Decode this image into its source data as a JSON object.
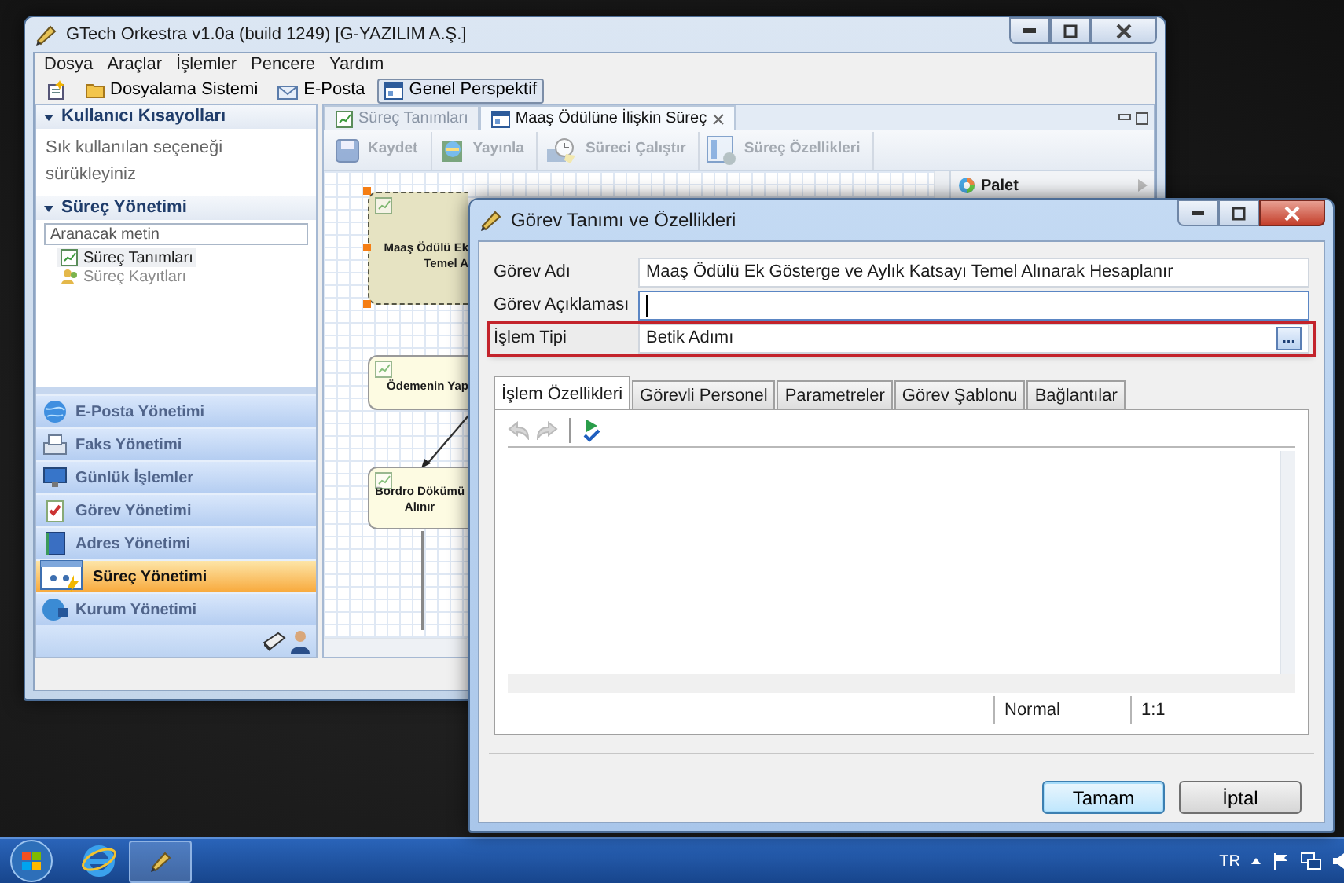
{
  "main_window": {
    "title": "GTech Orkestra v1.0a (build 1249) [G-YAZILIM A.Ş.]",
    "menu": [
      "Dosya",
      "Araçlar",
      "İşlemler",
      "Pencere",
      "Yardım"
    ],
    "toolbar": [
      {
        "kind": "new",
        "selected": false
      },
      {
        "kind": "folder",
        "label": "Dosyalama Sistemi",
        "selected": false
      },
      {
        "kind": "mail",
        "label": "E-Posta",
        "selected": false
      },
      {
        "kind": "perspective",
        "label": "Genel Perspektif",
        "selected": true
      }
    ],
    "sidebar": {
      "shortcuts": {
        "title": "Kullanıcı Kısayolları",
        "hint": "Sık kullanılan seçeneği sürükleyiniz"
      },
      "process": {
        "title": "Süreç Yönetimi",
        "search_placeholder": "Aranacak metin",
        "items": [
          {
            "label": "Süreç Tanımları",
            "selected": true,
            "disabled": false
          },
          {
            "label": "Süreç Kayıtları",
            "selected": false,
            "disabled": true
          }
        ]
      },
      "nav": [
        {
          "label": "E-Posta Yönetimi",
          "selected": false
        },
        {
          "label": "Faks Yönetimi",
          "selected": false
        },
        {
          "label": "Günlük İşlemler",
          "selected": false
        },
        {
          "label": "Görev Yönetimi",
          "selected": false
        },
        {
          "label": "Adres Yönetimi",
          "selected": false
        },
        {
          "label": "Süreç Yönetimi",
          "selected": true
        },
        {
          "label": "Kurum Yönetimi",
          "selected": false
        }
      ]
    },
    "editor_tabs": [
      {
        "label": "Süreç Tanımları",
        "selected": false,
        "closable": false
      },
      {
        "label": "Maaş Ödülüne İlişkin Süreç",
        "selected": true,
        "closable": true
      }
    ],
    "editor_toolbar": [
      {
        "kind": "save",
        "label": "Kaydet",
        "disabled": true
      },
      {
        "kind": "publish",
        "label": "Yayınla",
        "disabled": true
      },
      {
        "kind": "run",
        "label": "Süreci Çalıştır",
        "disabled": true
      },
      {
        "kind": "properties",
        "label": "Süreç Özellikleri",
        "disabled": true
      }
    ],
    "diagram": {
      "nodes": [
        {
          "lines": [
            "Maaş Ödülü Ek",
            "Temel A"
          ],
          "selected": true
        },
        {
          "lines": [
            "Ödemenin Yap"
          ],
          "selected": false
        },
        {
          "lines": [
            "Bordro Dökümü",
            "Alınır"
          ],
          "selected": false
        }
      ]
    },
    "palette": {
      "title": "Palet"
    }
  },
  "dialog": {
    "title": "Görev Tanımı ve Özellikleri",
    "fields": [
      {
        "label": "Görev Adı",
        "value": "Maaş Ödülü Ek Gösterge ve Aylık Katsayı Temel Alınarak Hesaplanır",
        "focused": false,
        "highlighted": false
      },
      {
        "label": "Görev Açıklaması",
        "focused": true,
        "highlighted": false
      },
      {
        "label": "İşlem Tipi",
        "value": "Betik Adımı",
        "focused": false,
        "highlighted": true,
        "browse": "..."
      }
    ],
    "tabs": [
      {
        "label": "İşlem Özellikleri",
        "selected": true
      },
      {
        "label": "Görevli Personel",
        "selected": false
      },
      {
        "label": "Parametreler",
        "selected": false
      },
      {
        "label": "Görev Şablonu",
        "selected": false
      },
      {
        "label": "Bağlantılar",
        "selected": false
      }
    ],
    "editor_actions": [
      {
        "kind": "undo",
        "disabled": true
      },
      {
        "kind": "redo",
        "disabled": true
      },
      {
        "kind": "run",
        "disabled": false
      }
    ],
    "status": [
      "Normal",
      "1:1"
    ],
    "buttons": [
      {
        "label": "Tamam",
        "default": true
      },
      {
        "label": "İptal",
        "default": false
      }
    ]
  },
  "taskbar": {
    "language": "TR"
  }
}
